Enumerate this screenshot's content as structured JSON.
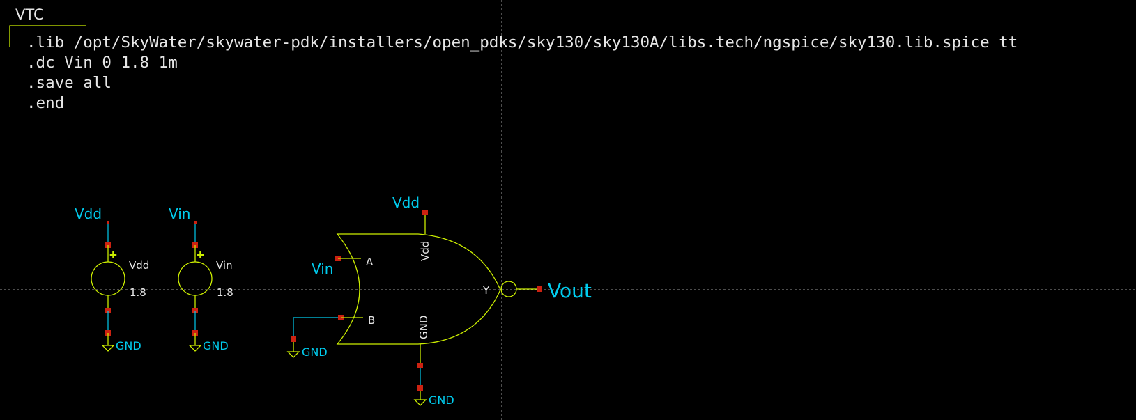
{
  "schematic": {
    "title": "VTC",
    "spice_lines": [
      ".lib /opt/SkyWater/skywater-pdk/installers/open_pdks/sky130/sky130A/libs.tech/ngspice/sky130.lib.spice tt",
      ".dc Vin 0 1.8 1m",
      ".save all",
      ".end"
    ],
    "sources": [
      {
        "net": "Vdd",
        "name": "Vdd",
        "value": "1.8",
        "plus": "+",
        "ground": "GND"
      },
      {
        "net": "Vin",
        "name": "Vin",
        "value": "1.8",
        "plus": "+",
        "ground": "GND"
      }
    ],
    "gate": {
      "pin_a": "A",
      "pin_b": "B",
      "pin_y": "Y",
      "pin_vdd": "Vdd",
      "pin_gnd": "GND",
      "net_a": "Vin",
      "net_vdd": "Vdd",
      "net_out": "Vout",
      "b_ground": "GND",
      "gnd_ground": "GND"
    }
  },
  "colors": {
    "background": "#000000",
    "symbol": "#ccee00",
    "wire": "#00ccee",
    "pin_marker": "#cc2211",
    "text": "#e6e6e6",
    "net_label": "#00ccee"
  }
}
